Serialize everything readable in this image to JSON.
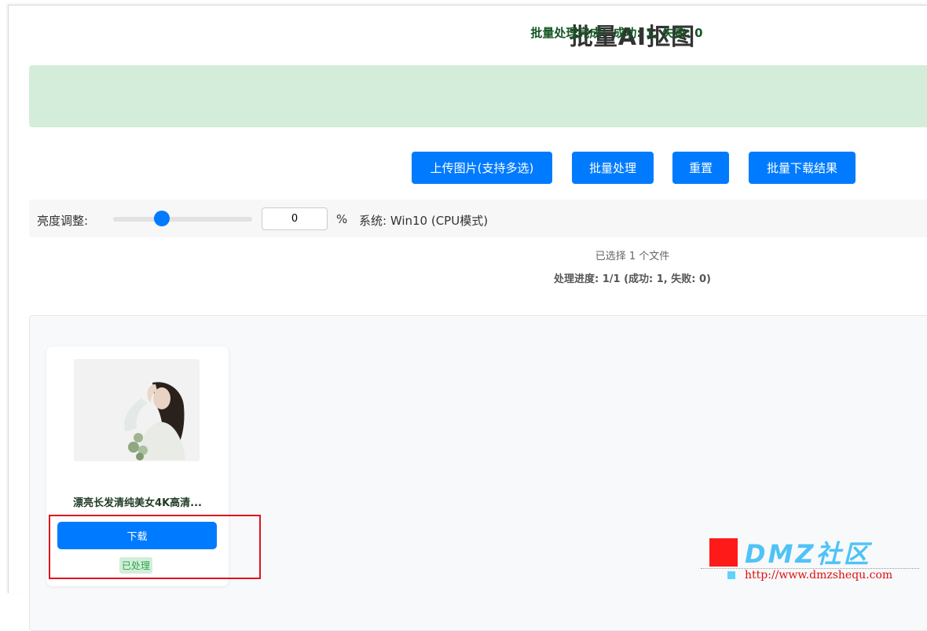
{
  "app": {
    "title": "批量AI抠图"
  },
  "banner": {
    "message": "批量处理完成！成功: 1, 失败: 0",
    "color": "#d4edda"
  },
  "toolbar": {
    "upload_label": "上传图片(支持多选)",
    "process_label": "批量处理",
    "reset_label": "重置",
    "download_all_label": "批量下载结果",
    "accent_color": "#007bff"
  },
  "controls": {
    "brightness_label": "亮度调整:",
    "brightness_value": "0",
    "brightness_level_fraction": 0.35,
    "percent_sign": "%",
    "system_info": "系统: Win10 (CPU模式)"
  },
  "status": {
    "file_count": "已选择 1 个文件",
    "progress": "处理进度: 1/1 (成功: 1, 失败: 0)"
  },
  "results": [
    {
      "name": "漂亮长发清纯美女4K高清...",
      "download_label": "下载",
      "status": "已处理"
    }
  ],
  "watermark": {
    "brand": "DMZ社区",
    "url": "http://www.dmzshequ.com"
  }
}
